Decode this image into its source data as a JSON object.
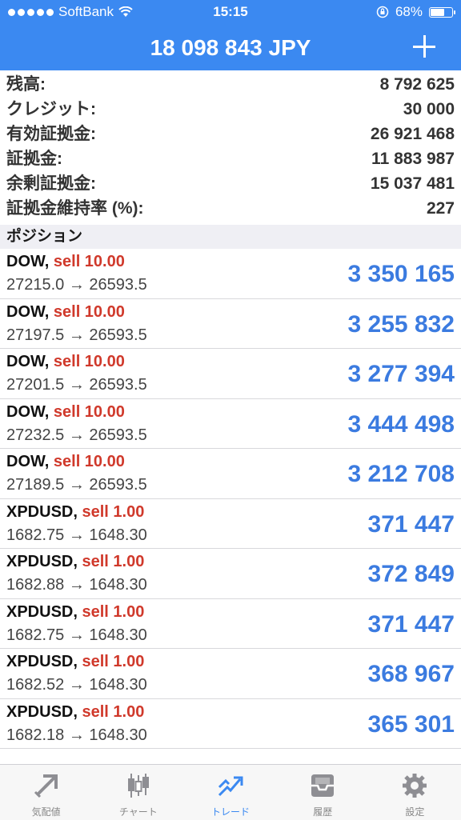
{
  "status_bar": {
    "carrier": "SoftBank",
    "time": "15:15",
    "battery": "68%",
    "battery_level": 0.68
  },
  "header": {
    "title": "18 098 843 JPY"
  },
  "summary": [
    {
      "label": "残高:",
      "value": "8 792 625"
    },
    {
      "label": "クレジット:",
      "value": "30 000"
    },
    {
      "label": "有効証拠金:",
      "value": "26 921 468"
    },
    {
      "label": "証拠金:",
      "value": "11 883 987"
    },
    {
      "label": "余剰証拠金:",
      "value": "15 037 481"
    },
    {
      "label": "証拠金維持率 (%):",
      "value": "227"
    }
  ],
  "positions_header": "ポジション",
  "positions": [
    {
      "symbol": "DOW,",
      "side": "sell 10.00",
      "prices": "27215.0 → 26593.5",
      "profit": "3 350 165"
    },
    {
      "symbol": "DOW,",
      "side": "sell 10.00",
      "prices": "27197.5 → 26593.5",
      "profit": "3 255 832"
    },
    {
      "symbol": "DOW,",
      "side": "sell 10.00",
      "prices": "27201.5 → 26593.5",
      "profit": "3 277 394"
    },
    {
      "symbol": "DOW,",
      "side": "sell 10.00",
      "prices": "27232.5 → 26593.5",
      "profit": "3 444 498"
    },
    {
      "symbol": "DOW,",
      "side": "sell 10.00",
      "prices": "27189.5 → 26593.5",
      "profit": "3 212 708"
    },
    {
      "symbol": "XPDUSD,",
      "side": "sell 1.00",
      "prices": "1682.75 → 1648.30",
      "profit": "371 447"
    },
    {
      "symbol": "XPDUSD,",
      "side": "sell 1.00",
      "prices": "1682.88 → 1648.30",
      "profit": "372 849"
    },
    {
      "symbol": "XPDUSD,",
      "side": "sell 1.00",
      "prices": "1682.75 → 1648.30",
      "profit": "371 447"
    },
    {
      "symbol": "XPDUSD,",
      "side": "sell 1.00",
      "prices": "1682.52 → 1648.30",
      "profit": "368 967"
    },
    {
      "symbol": "XPDUSD,",
      "side": "sell 1.00",
      "prices": "1682.18 → 1648.30",
      "profit": "365 301"
    }
  ],
  "tabs": [
    {
      "label": "気配値",
      "icon": "quotes-icon"
    },
    {
      "label": "チャート",
      "icon": "chart-icon"
    },
    {
      "label": "トレード",
      "icon": "trade-icon",
      "active": true
    },
    {
      "label": "履歴",
      "icon": "history-icon"
    },
    {
      "label": "設定",
      "icon": "settings-icon"
    }
  ],
  "colors": {
    "accent": "#3b89f1",
    "profit": "#3b7be0",
    "sell": "#d0392b"
  }
}
